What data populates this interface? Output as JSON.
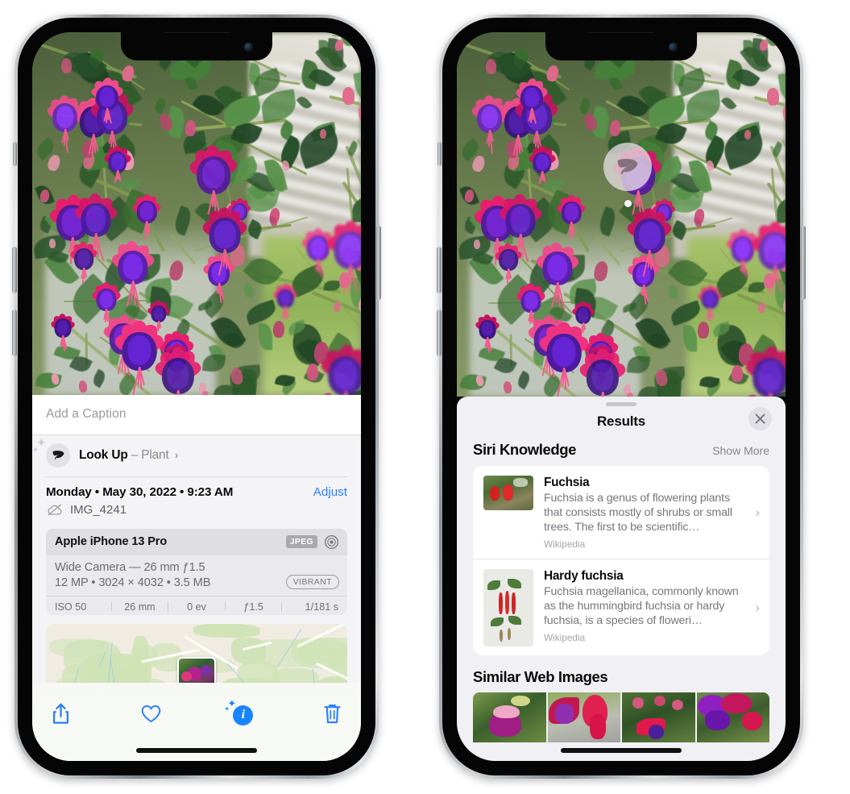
{
  "left_phone": {
    "caption_placeholder": "Add a Caption",
    "lookup": {
      "label": "Look Up",
      "dash": "–",
      "subject": "Plant",
      "chevron": "›",
      "icon": "leaf-icon"
    },
    "metadata": {
      "date_line": "Monday • May 30, 2022 • 9:23 AM",
      "adjust_label": "Adjust",
      "filename": "IMG_4241",
      "cloud_icon": "cloud-slash-icon"
    },
    "exif": {
      "device": "Apple iPhone 13 Pro",
      "format_chip": "JPEG",
      "aperture_icon": "aperture-icon",
      "lens_line": "Wide Camera — 26 mm ƒ1.5",
      "size_line": "12 MP • 3024 × 4032 • 3.5 MB",
      "style_chip": "VIBRANT",
      "stats": [
        "ISO 50",
        "26 mm",
        "0 ev",
        "ƒ1.5",
        "1/181 s"
      ]
    },
    "toolbar": {
      "share_label": "share-icon",
      "favorite_label": "heart-icon",
      "info_label": "info-sparkle-icon",
      "delete_label": "trash-icon"
    }
  },
  "right_phone": {
    "visual_lookup_badge": "leaf-icon",
    "sheet": {
      "title": "Results",
      "close_icon": "close-icon",
      "sections": [
        {
          "title": "Siri Knowledge",
          "action": "Show More",
          "items": [
            {
              "title": "Fuchsia",
              "description": "Fuchsia is a genus of flowering plants that consists mostly of shrubs or small trees. The first to be scientific…",
              "source": "Wikipedia",
              "chevron": "›"
            },
            {
              "title": "Hardy fuchsia",
              "description": "Fuchsia magellanica, commonly known as the hummingbird fuchsia or hardy fuchsia, is a species of floweri…",
              "source": "Wikipedia",
              "chevron": "›"
            }
          ]
        },
        {
          "title": "Similar Web Images",
          "images": [
            "web-image-1",
            "web-image-2",
            "web-image-3",
            "web-image-4"
          ]
        }
      ]
    }
  },
  "colors": {
    "accent_blue": "#2a7fff",
    "sheet_bg": "#f1f0f5",
    "panel_bg": "#f4f4f7",
    "card_bg": "#ffffff",
    "muted_text": "#76767e"
  }
}
